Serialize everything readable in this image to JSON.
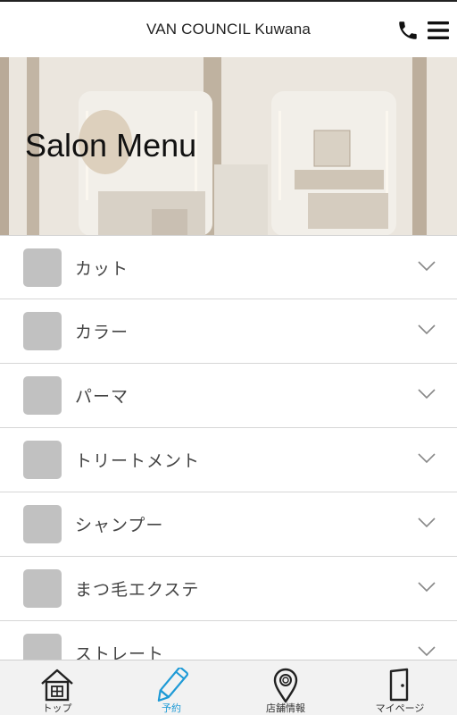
{
  "header": {
    "title": "VAN COUNCIL Kuwana"
  },
  "hero": {
    "title": "Salon Menu"
  },
  "menu": {
    "items": [
      {
        "label": "カット"
      },
      {
        "label": "カラー"
      },
      {
        "label": "パーマ"
      },
      {
        "label": "トリートメント"
      },
      {
        "label": "シャンプー"
      },
      {
        "label": "まつ毛エクステ"
      },
      {
        "label": "ストレート"
      }
    ]
  },
  "tabbar": {
    "items": [
      {
        "label": "トップ",
        "icon": "home-icon"
      },
      {
        "label": "予約",
        "icon": "pencil-icon",
        "active": true
      },
      {
        "label": "店舗情報",
        "icon": "map-pin-icon"
      },
      {
        "label": "マイページ",
        "icon": "door-icon"
      }
    ]
  },
  "colors": {
    "accent": "#1e9ad6",
    "thumb": "#c1c1c1"
  }
}
